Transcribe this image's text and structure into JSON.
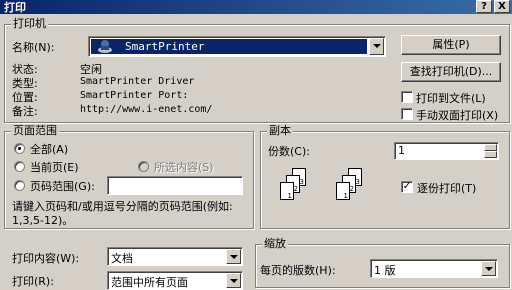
{
  "window": {
    "title": "打印",
    "help_label": "?",
    "close_label": "X"
  },
  "printer": {
    "group_label": "打印机",
    "name_label": "名称(N):",
    "name_value": "SmartPrinter",
    "properties_button": "属性(P)",
    "find_button": "查找打印机(D)...",
    "status_label": "状态:",
    "status_value": "空闲",
    "type_label": "类型:",
    "type_value": "SmartPrinter Driver",
    "where_label": "位置:",
    "where_value": "SmartPrinter Port:",
    "comment_label": "备注:",
    "comment_value": "http://www.i-enet.com/",
    "print_to_file": "打印到文件(L)",
    "manual_duplex": "手动双面打印(X)"
  },
  "page_range": {
    "group_label": "页面范围",
    "all": "全部(A)",
    "current": "当前页(E)",
    "selection": "所选内容(S)",
    "pages": "页码范围(G):",
    "pages_value": "",
    "hint": "请键入页码和/或用逗号分隔的页码范围(例如: 1,3,5-12)。"
  },
  "copies": {
    "group_label": "副本",
    "count_label": "份数(C):",
    "count_value": "1",
    "collate_label": "逐份打印(T)",
    "collate_checked": true,
    "page_numbers": [
      "1",
      "2",
      "3"
    ]
  },
  "print_what": {
    "label": "打印内容(W):",
    "value": "文档"
  },
  "print": {
    "label": "打印(R):",
    "value": "范围中所有页面"
  },
  "zoom": {
    "group_label": "缩放",
    "pages_per_sheet_label": "每页的版数(H):",
    "pages_per_sheet_value": "1 版"
  }
}
